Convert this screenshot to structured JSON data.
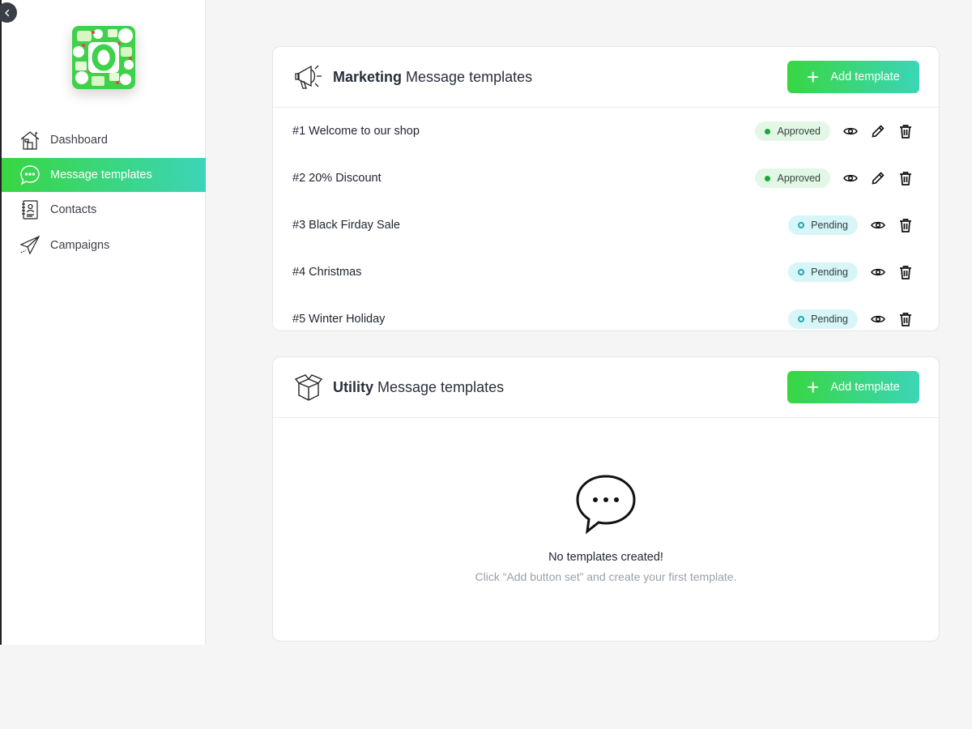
{
  "sidebar": {
    "items": [
      {
        "label": "Dashboard",
        "icon": "house-icon"
      },
      {
        "label": "Message templates",
        "icon": "chat-bubble-icon",
        "active": true
      },
      {
        "label": "Contacts",
        "icon": "contact-book-icon"
      },
      {
        "label": "Campaigns",
        "icon": "paper-plane-icon"
      }
    ]
  },
  "marketing": {
    "title_bold": "Marketing",
    "title_rest": " Message templates",
    "add_label": "Add template",
    "templates": [
      {
        "name": "#1 Welcome to our shop",
        "status": "Approved"
      },
      {
        "name": "#2 20% Discount",
        "status": "Approved"
      },
      {
        "name": "#3 Black Firday Sale",
        "status": "Pending"
      },
      {
        "name": "#4 Christmas",
        "status": "Pending"
      },
      {
        "name": "#5 Winter Holiday",
        "status": "Pending"
      }
    ]
  },
  "utility": {
    "title_bold": "Utility",
    "title_rest": " Message templates",
    "add_label": "Add template",
    "empty_title": "No templates created!",
    "empty_subtitle": "Click “Add button set” and create your first template."
  },
  "colors": {
    "gradient_start": "#38d642",
    "gradient_end": "#3cd5b8",
    "approved_dot": "#1aa83a",
    "pending_ring": "#1ea7b0"
  }
}
